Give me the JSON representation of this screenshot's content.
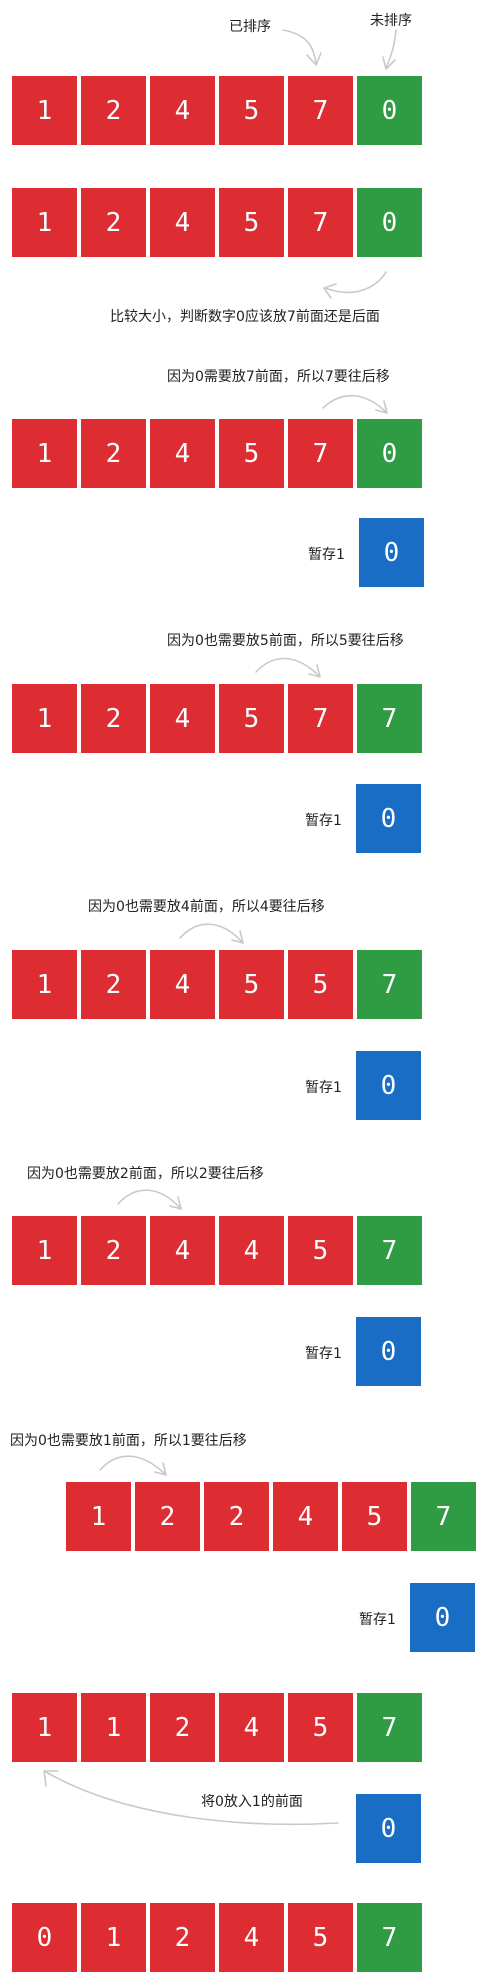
{
  "colors": {
    "sorted": "#dd2d33",
    "unsorted": "#2f9c43",
    "temp": "#1a6dc4",
    "arrow": "#c9c9c9"
  },
  "labels": {
    "sorted": "已排序",
    "unsorted": "未排序",
    "compare": "比较大小，判断数字0应该放7前面还是后面",
    "step3": "因为0需要放7前面，所以7要往后移",
    "step4": "因为0也需要放5前面，所以5要往后移",
    "step5": "因为0也需要放4前面，所以4要往后移",
    "step6": "因为0也需要放2前面，所以2要往后移",
    "step7": "因为0也需要放1前面，所以1要往后移",
    "step8": "将0放入1的前面",
    "temp": "暂存1"
  },
  "rows": [
    {
      "values": [
        "1",
        "2",
        "4",
        "5",
        "7",
        "0"
      ],
      "colors": [
        "red",
        "red",
        "red",
        "red",
        "red",
        "green"
      ]
    },
    {
      "values": [
        "1",
        "2",
        "4",
        "5",
        "7",
        "0"
      ],
      "colors": [
        "red",
        "red",
        "red",
        "red",
        "red",
        "green"
      ]
    },
    {
      "values": [
        "1",
        "2",
        "4",
        "5",
        "7",
        "0"
      ],
      "colors": [
        "red",
        "red",
        "red",
        "red",
        "red",
        "green"
      ]
    },
    {
      "values": [
        "1",
        "2",
        "4",
        "5",
        "7",
        "7"
      ],
      "colors": [
        "red",
        "red",
        "red",
        "red",
        "red",
        "green"
      ]
    },
    {
      "values": [
        "1",
        "2",
        "4",
        "5",
        "5",
        "7"
      ],
      "colors": [
        "red",
        "red",
        "red",
        "red",
        "red",
        "green"
      ]
    },
    {
      "values": [
        "1",
        "2",
        "4",
        "4",
        "5",
        "7"
      ],
      "colors": [
        "red",
        "red",
        "red",
        "red",
        "red",
        "green"
      ]
    },
    {
      "values": [
        "1",
        "2",
        "2",
        "4",
        "5",
        "7"
      ],
      "colors": [
        "red",
        "red",
        "red",
        "red",
        "red",
        "green"
      ]
    },
    {
      "values": [
        "1",
        "1",
        "2",
        "4",
        "5",
        "7"
      ],
      "colors": [
        "red",
        "red",
        "red",
        "red",
        "red",
        "green"
      ]
    },
    {
      "values": [
        "0",
        "1",
        "2",
        "4",
        "5",
        "7"
      ],
      "colors": [
        "red",
        "red",
        "red",
        "red",
        "red",
        "green"
      ]
    }
  ],
  "temp_value": "0"
}
